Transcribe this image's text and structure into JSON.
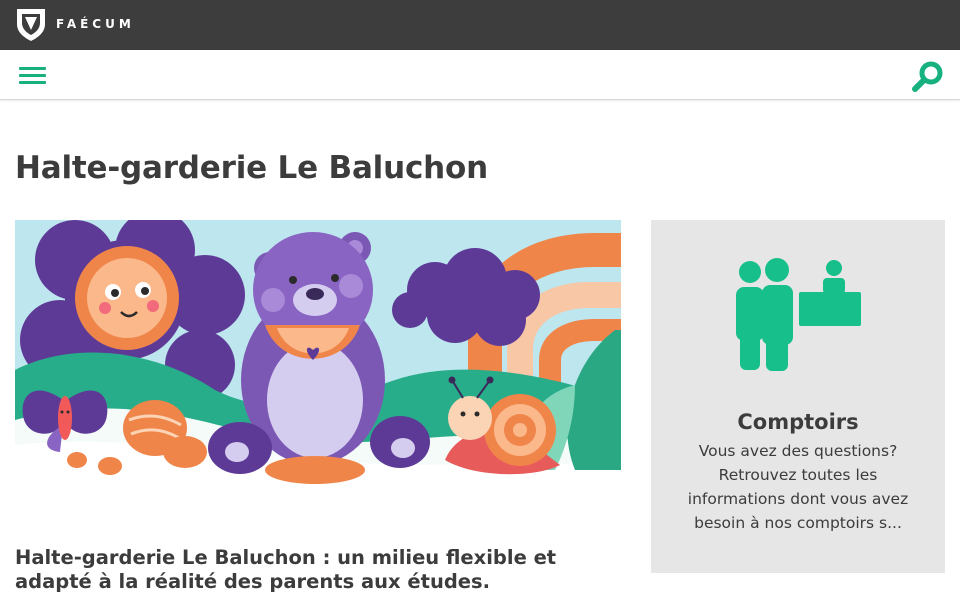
{
  "header": {
    "brand": "FAÉCUM",
    "accent_color": "#17b07f",
    "topbar_color": "#3d3d3d"
  },
  "nav": {
    "menu_icon": "hamburger-menu-icon",
    "search_icon": "search-icon"
  },
  "page": {
    "title": "Halte-garderie Le Baluchon",
    "subtitle": "Halte-garderie Le Baluchon : un milieu flexible et adapté à la réalité des parents aux études."
  },
  "hero": {
    "illustration": "bear-flower-snail-butterfly-illustration"
  },
  "sidebar_card": {
    "icon": "people-at-counter-icon",
    "title": "Comptoirs",
    "description": "Vous avez des questions? Retrouvez toutes les informations dont vous avez besoin à nos comptoirs s..."
  }
}
